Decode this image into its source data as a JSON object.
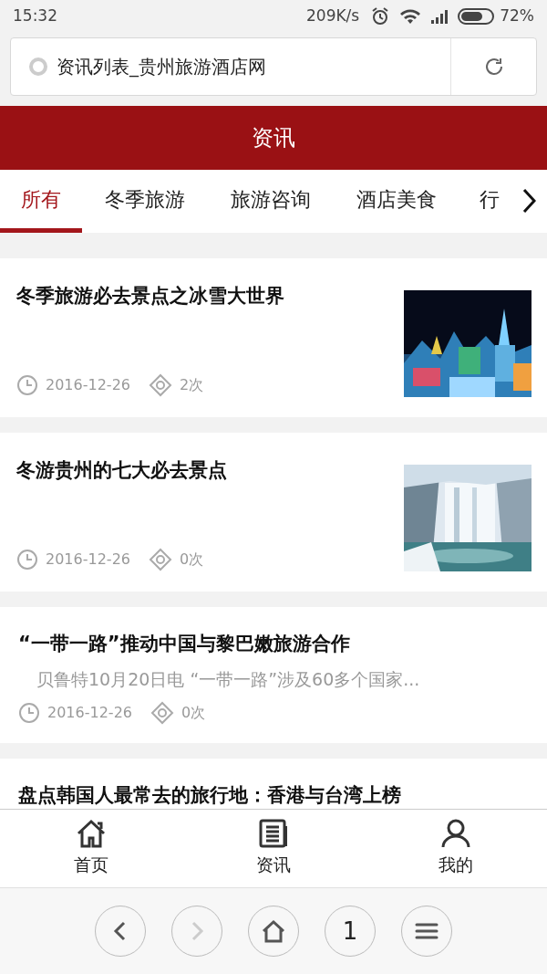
{
  "status_bar": {
    "time": "15:32",
    "speed": "209K/s",
    "battery": "72%"
  },
  "address_bar": {
    "title": "资讯列表_贵州旅游酒店网"
  },
  "header": {
    "title": "资讯"
  },
  "tabs": [
    {
      "label": "所有",
      "selected": true
    },
    {
      "label": "冬季旅游",
      "selected": false
    },
    {
      "label": "旅游咨询",
      "selected": false
    },
    {
      "label": "酒店美食",
      "selected": false
    },
    {
      "label": "行",
      "selected": false
    }
  ],
  "articles": [
    {
      "title": "冬季旅游必去景点之冰雪大世界",
      "date": "2016-12-26",
      "views": "2次"
    },
    {
      "title": "冬游贵州的七大必去景点",
      "date": "2016-12-26",
      "views": "0次"
    },
    {
      "title": "“一带一路”推动中国与黎巴嫩旅游合作",
      "summary": "贝鲁特10月20日电 “一带一路”涉及60多个国家...",
      "date": "2016-12-26",
      "views": "0次"
    },
    {
      "title": "盘点韩国人最常去的旅行地：香港与台湾上榜"
    }
  ],
  "bottom_nav": [
    {
      "label": "首页",
      "kind": "home"
    },
    {
      "label": "资讯",
      "kind": "news"
    },
    {
      "label": "我的",
      "kind": "user"
    }
  ],
  "browser_bar": [
    {
      "kind": "back",
      "disabled": false
    },
    {
      "kind": "forward",
      "disabled": true
    },
    {
      "kind": "home",
      "disabled": false
    },
    {
      "kind": "tabs",
      "label": "1",
      "disabled": false
    },
    {
      "kind": "menu",
      "disabled": false
    }
  ]
}
